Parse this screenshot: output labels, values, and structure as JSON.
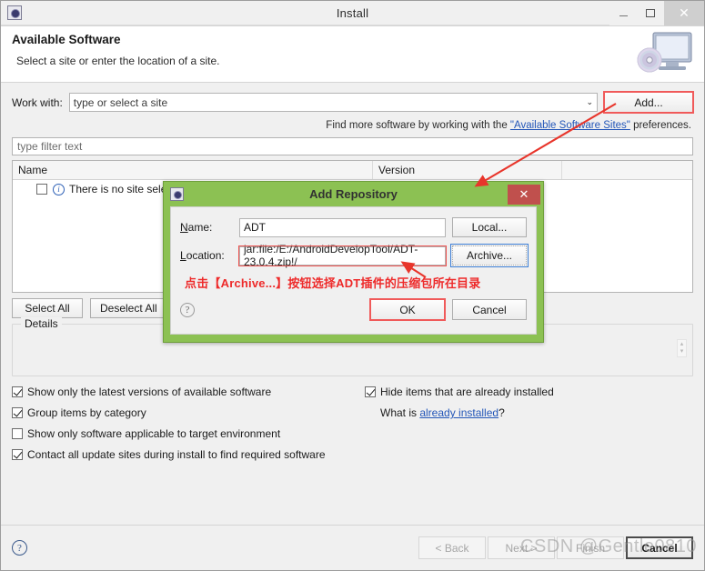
{
  "window": {
    "title": "Install",
    "icon": "eclipse-icon",
    "minimize_label": "–",
    "maximize_label": "□",
    "close_label": "✕"
  },
  "banner": {
    "title": "Available Software",
    "subtitle": "Select a site or enter the location of a site.",
    "art_icon": "monitor-cd-icon"
  },
  "work_with": {
    "label": "Work with:",
    "value": "type or select a site",
    "chevron": "⌄",
    "add_button": "Add..."
  },
  "hint": {
    "prefix": "Find more software by working with the ",
    "link": "\"Available Software Sites\"",
    "suffix": " preferences."
  },
  "filter": {
    "placeholder": "type filter text"
  },
  "table": {
    "columns": [
      "Name",
      "Version"
    ],
    "rows": [
      {
        "checked": false,
        "icon": "info-icon",
        "name": "There is no site select"
      }
    ]
  },
  "selection_buttons": {
    "select_all": "Select All",
    "deselect_all": "Deselect All"
  },
  "details": {
    "legend": "Details",
    "body": "",
    "spinner_up": "▴",
    "spinner_down": "▾"
  },
  "options": {
    "left": [
      {
        "label": "Show only the latest versions of available software",
        "checked": true
      },
      {
        "label": "Group items by category",
        "checked": true
      },
      {
        "label": "Show only software applicable to target environment",
        "checked": false
      },
      {
        "label": "Contact all update sites during install to find required software",
        "checked": true
      }
    ],
    "right": [
      {
        "label": "Hide items that are already installed",
        "checked": true
      }
    ],
    "what_is_prefix": "What is ",
    "what_is_link": "already installed",
    "what_is_suffix": "?"
  },
  "footer": {
    "help_icon": "?",
    "buttons": [
      {
        "label": "< Back",
        "state": "disabled"
      },
      {
        "label": "Next >",
        "state": "disabled"
      },
      {
        "label": "Finish",
        "state": "disabled"
      },
      {
        "label": "Cancel",
        "state": "default"
      }
    ]
  },
  "dialog": {
    "title": "Add Repository",
    "icon": "eclipse-icon",
    "close_label": "✕",
    "name_label": "Name:",
    "name_label_mnemonic": "N",
    "name_value": "ADT",
    "local_button": "Local...",
    "location_label": "Location:",
    "location_label_mnemonic": "L",
    "location_value": "jar:file:/E:/AndroidDevelopTool/ADT-23.0.4.zip!/",
    "archive_button": "Archive...",
    "annotation": "点击【Archive...】按钮选择ADT插件的压缩包所在目录",
    "help_icon": "?",
    "ok_button": "OK",
    "cancel_button": "Cancel"
  },
  "watermark": "CSDN @Gentle0810",
  "colors": {
    "dialog_accent": "#8cc153",
    "annotation_red": "#ee2a2a",
    "highlight_red": "#ef5350",
    "link_blue": "#2356b8",
    "close_red": "#c0504d"
  }
}
